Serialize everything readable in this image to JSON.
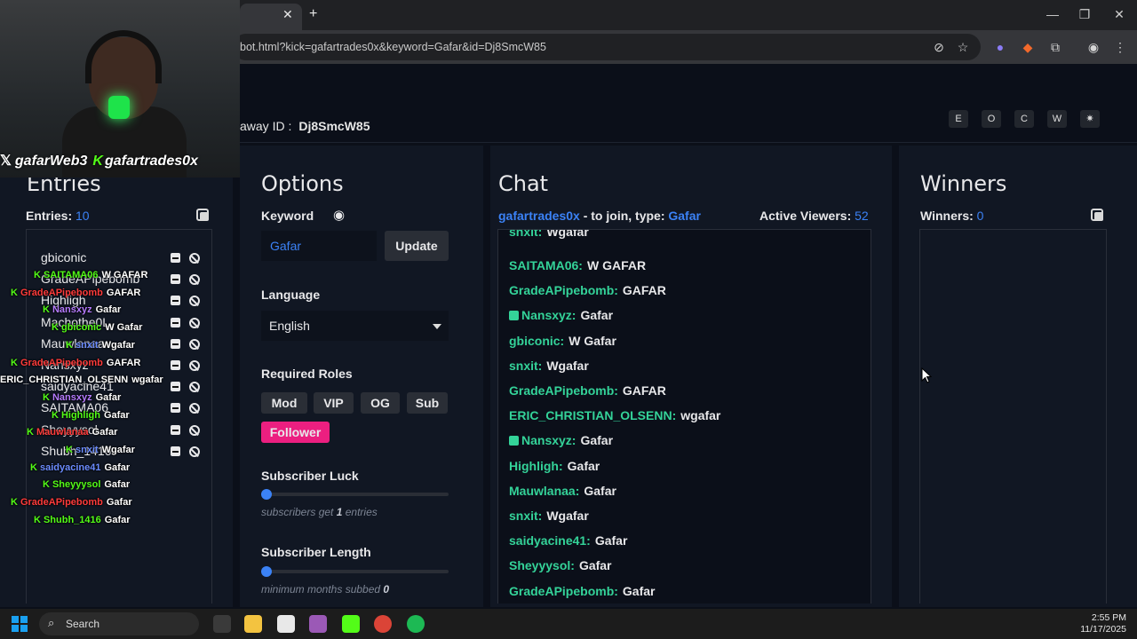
{
  "browser": {
    "url": "bot.html?kick=gafartrades0x&keyword=Gafar&id=Dj8SmcW85",
    "close_tab": "✕",
    "new_tab": "+",
    "minimize": "—",
    "maximize": "❐",
    "close_window": "✕"
  },
  "header": {
    "giveaway_label": "away ID :",
    "giveaway_id": "Dj8SmcW85",
    "theme_buttons": [
      "E",
      "O",
      "C",
      "W",
      "✷"
    ]
  },
  "entries": {
    "title": "Entries",
    "label": "Entries:",
    "count": "10",
    "items": [
      "gbiconic",
      "GradeAPipebomb",
      "Highligh",
      "Machothe0L",
      "Mauwlanaa",
      "Nansxyz",
      "saidyacine41",
      "SAITAMA06",
      "Sheyyysol",
      "Shubh_1416"
    ]
  },
  "overlay": {
    "streamer_x": "gafarWeb3",
    "streamer_kick": "gafartrades0x",
    "lines": [
      {
        "user": "SAITAMA06",
        "msg": "W GAFAR",
        "color": "#53fc18"
      },
      {
        "user": "GradeAPipebomb",
        "msg": "GAFAR",
        "color": "#ff3b3b"
      },
      {
        "user": "Nansxyz",
        "msg": "Gafar",
        "color": "#b57bff"
      },
      {
        "user": "gbiconic",
        "msg": "W Gafar",
        "color": "#53fc18"
      },
      {
        "user": "snxit",
        "msg": "Wgafar",
        "color": "#6b8cff"
      },
      {
        "user": "GradeAPipebomb",
        "msg": "GAFAR",
        "color": "#ff3b3b"
      },
      {
        "user": "ERIC_CHRISTIAN_OLSENN",
        "msg": "wgafar",
        "color": "#ffffff"
      },
      {
        "user": "Nansxyz",
        "msg": "Gafar",
        "color": "#b57bff"
      },
      {
        "user": "Highligh",
        "msg": "Gafar",
        "color": "#53fc18"
      },
      {
        "user": "Mauwlanaa",
        "msg": "Gafar",
        "color": "#ff3b3b"
      },
      {
        "user": "snxit",
        "msg": "Wgafar",
        "color": "#6b8cff"
      },
      {
        "user": "saidyacine41",
        "msg": "Gafar",
        "color": "#6b8cff"
      },
      {
        "user": "Sheyyysol",
        "msg": "Gafar",
        "color": "#53fc18"
      },
      {
        "user": "GradeAPipebomb",
        "msg": "Gafar",
        "color": "#ff3b3b"
      },
      {
        "user": "Shubh_1416",
        "msg": "Gafar",
        "color": "#53fc18"
      }
    ]
  },
  "options": {
    "title": "Options",
    "keyword_label": "Keyword",
    "keyword_value": "Gafar",
    "update_button": "Update",
    "language_label": "Language",
    "language_value": "English",
    "roles_label": "Required Roles",
    "roles": [
      "Mod",
      "VIP",
      "OG",
      "Sub",
      "Follower"
    ],
    "sub_luck_label": "Subscriber Luck",
    "sub_luck_hint_pre": "subscribers get",
    "sub_luck_value": "1",
    "sub_luck_hint_post": "entries",
    "sub_length_label": "Subscriber Length",
    "sub_length_hint": "minimum months subbed",
    "sub_length_value": "0"
  },
  "chat": {
    "title": "Chat",
    "channel": "gafartrades0x",
    "join_text": "- to join, type:",
    "keyword": "Gafar",
    "viewers_label": "Active Viewers:",
    "viewers": "52",
    "messages": [
      {
        "user": "snxit:",
        "msg": "Wgafar",
        "badge": false
      },
      {
        "user": "SAITAMA06:",
        "msg": "W GAFAR",
        "badge": false
      },
      {
        "user": "GradeAPipebomb:",
        "msg": "GAFAR",
        "badge": false
      },
      {
        "user": "Nansxyz:",
        "msg": "Gafar",
        "badge": true
      },
      {
        "user": "gbiconic:",
        "msg": "W Gafar",
        "badge": false
      },
      {
        "user": "snxit:",
        "msg": "Wgafar",
        "badge": false
      },
      {
        "user": "GradeAPipebomb:",
        "msg": "GAFAR",
        "badge": false
      },
      {
        "user": "ERIC_CHRISTIAN_OLSENN:",
        "msg": "wgafar",
        "badge": false
      },
      {
        "user": "Nansxyz:",
        "msg": "Gafar",
        "badge": true
      },
      {
        "user": "Highligh:",
        "msg": "Gafar",
        "badge": false
      },
      {
        "user": "Mauwlanaa:",
        "msg": "Gafar",
        "badge": false
      },
      {
        "user": "snxit:",
        "msg": "Wgafar",
        "badge": false
      },
      {
        "user": "saidyacine41:",
        "msg": "Gafar",
        "badge": false
      },
      {
        "user": "Sheyyysol:",
        "msg": "Gafar",
        "badge": false
      },
      {
        "user": "GradeAPipebomb:",
        "msg": "Gafar",
        "badge": false
      }
    ]
  },
  "winners": {
    "title": "Winners",
    "label": "Winners:",
    "count": "0"
  },
  "taskbar": {
    "search": "Search",
    "time": "2:55 PM",
    "date": "11/17/2025"
  },
  "colors": {
    "accent": "#3b82f6",
    "chat_user": "#34d399",
    "follower": "#ec1f80",
    "kick_green": "#53fc18"
  }
}
